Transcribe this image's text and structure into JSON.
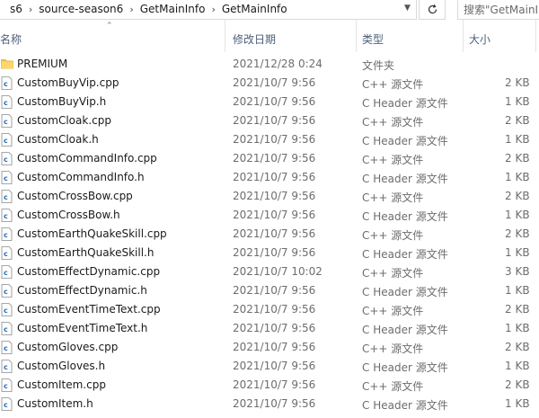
{
  "address": {
    "breadcrumbs": [
      "s6",
      "source-season6",
      "GetMainInfo",
      "GetMainInfo"
    ],
    "separator": "›"
  },
  "search": {
    "placeholder": "搜索\"GetMainI"
  },
  "columns": {
    "name": "名称",
    "date": "修改日期",
    "type": "类型",
    "size": "大小"
  },
  "files": [
    {
      "name": "PREMIUM",
      "date": "2021/12/28 0:24",
      "type": "文件夹",
      "size": "",
      "icon": "folder-icon"
    },
    {
      "name": "CustomBuyVip.cpp",
      "date": "2021/10/7 9:56",
      "type": "C++ 源文件",
      "size": "2 KB",
      "icon": "cpp-file-icon"
    },
    {
      "name": "CustomBuyVip.h",
      "date": "2021/10/7 9:56",
      "type": "C Header 源文件",
      "size": "1 KB",
      "icon": "header-file-icon"
    },
    {
      "name": "CustomCloak.cpp",
      "date": "2021/10/7 9:56",
      "type": "C++ 源文件",
      "size": "2 KB",
      "icon": "cpp-file-icon"
    },
    {
      "name": "CustomCloak.h",
      "date": "2021/10/7 9:56",
      "type": "C Header 源文件",
      "size": "1 KB",
      "icon": "header-file-icon"
    },
    {
      "name": "CustomCommandInfo.cpp",
      "date": "2021/10/7 9:56",
      "type": "C++ 源文件",
      "size": "2 KB",
      "icon": "cpp-file-icon"
    },
    {
      "name": "CustomCommandInfo.h",
      "date": "2021/10/7 9:56",
      "type": "C Header 源文件",
      "size": "1 KB",
      "icon": "header-file-icon"
    },
    {
      "name": "CustomCrossBow.cpp",
      "date": "2021/10/7 9:56",
      "type": "C++ 源文件",
      "size": "2 KB",
      "icon": "cpp-file-icon"
    },
    {
      "name": "CustomCrossBow.h",
      "date": "2021/10/7 9:56",
      "type": "C Header 源文件",
      "size": "1 KB",
      "icon": "header-file-icon"
    },
    {
      "name": "CustomEarthQuakeSkill.cpp",
      "date": "2021/10/7 9:56",
      "type": "C++ 源文件",
      "size": "2 KB",
      "icon": "cpp-file-icon"
    },
    {
      "name": "CustomEarthQuakeSkill.h",
      "date": "2021/10/7 9:56",
      "type": "C Header 源文件",
      "size": "1 KB",
      "icon": "header-file-icon"
    },
    {
      "name": "CustomEffectDynamic.cpp",
      "date": "2021/10/7 10:02",
      "type": "C++ 源文件",
      "size": "3 KB",
      "icon": "cpp-file-icon"
    },
    {
      "name": "CustomEffectDynamic.h",
      "date": "2021/10/7 9:56",
      "type": "C Header 源文件",
      "size": "1 KB",
      "icon": "header-file-icon"
    },
    {
      "name": "CustomEventTimeText.cpp",
      "date": "2021/10/7 9:56",
      "type": "C++ 源文件",
      "size": "2 KB",
      "icon": "cpp-file-icon"
    },
    {
      "name": "CustomEventTimeText.h",
      "date": "2021/10/7 9:56",
      "type": "C Header 源文件",
      "size": "1 KB",
      "icon": "header-file-icon"
    },
    {
      "name": "CustomGloves.cpp",
      "date": "2021/10/7 9:56",
      "type": "C++ 源文件",
      "size": "2 KB",
      "icon": "cpp-file-icon"
    },
    {
      "name": "CustomGloves.h",
      "date": "2021/10/7 9:56",
      "type": "C Header 源文件",
      "size": "1 KB",
      "icon": "header-file-icon"
    },
    {
      "name": "CustomItem.cpp",
      "date": "2021/10/7 9:56",
      "type": "C++ 源文件",
      "size": "2 KB",
      "icon": "cpp-file-icon"
    },
    {
      "name": "CustomItem.h",
      "date": "2021/10/7 9:56",
      "type": "C Header 源文件",
      "size": "1 KB",
      "icon": "header-file-icon"
    }
  ],
  "colors": {
    "header_text": "#4c607a",
    "folder": "#f5c34d",
    "file_icon_accent": "#2e6fb7"
  }
}
